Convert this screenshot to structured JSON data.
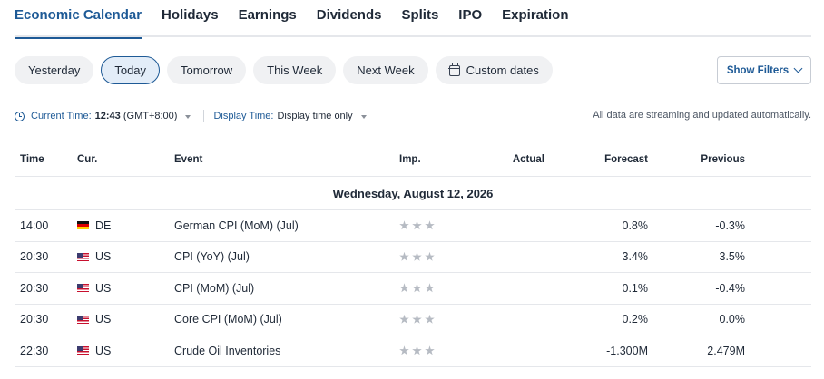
{
  "tabs": [
    {
      "label": "Economic Calendar",
      "active": true
    },
    {
      "label": "Holidays"
    },
    {
      "label": "Earnings"
    },
    {
      "label": "Dividends"
    },
    {
      "label": "Splits"
    },
    {
      "label": "IPO"
    },
    {
      "label": "Expiration"
    }
  ],
  "filters": {
    "yesterday": "Yesterday",
    "today": "Today",
    "tomorrow": "Tomorrow",
    "this_week": "This Week",
    "next_week": "Next Week",
    "custom_dates": "Custom dates",
    "show_filters": "Show Filters"
  },
  "timebar": {
    "current_label": "Current Time:",
    "current_time": "12:43",
    "timezone": "(GMT+8:00)",
    "display_label": "Display Time:",
    "display_value": "Display time only",
    "streaming_note": "All data are streaming and updated automatically."
  },
  "table": {
    "headers": {
      "time": "Time",
      "currency": "Cur.",
      "event": "Event",
      "importance": "Imp.",
      "actual": "Actual",
      "forecast": "Forecast",
      "previous": "Previous"
    },
    "date_label": "Wednesday, August 12, 2026",
    "rows": [
      {
        "time": "14:00",
        "flag": "de-flag-icon",
        "currency": "DE",
        "event": "German CPI (MoM) (Jul)",
        "importance": 3,
        "actual": "",
        "forecast": "0.8%",
        "previous": "-0.3%"
      },
      {
        "time": "20:30",
        "flag": "us-flag-icon",
        "currency": "US",
        "event": "CPI (YoY) (Jul)",
        "importance": 3,
        "actual": "",
        "forecast": "3.4%",
        "previous": "3.5%"
      },
      {
        "time": "20:30",
        "flag": "us-flag-icon",
        "currency": "US",
        "event": "CPI (MoM) (Jul)",
        "importance": 3,
        "actual": "",
        "forecast": "0.1%",
        "previous": "-0.4%"
      },
      {
        "time": "20:30",
        "flag": "us-flag-icon",
        "currency": "US",
        "event": "Core CPI (MoM) (Jul)",
        "importance": 3,
        "actual": "",
        "forecast": "0.2%",
        "previous": "0.0%"
      },
      {
        "time": "22:30",
        "flag": "us-flag-icon",
        "currency": "US",
        "event": "Crude Oil Inventories",
        "importance": 3,
        "actual": "",
        "forecast": "-1.300M",
        "previous": "2.479M"
      }
    ]
  },
  "colors": {
    "accent": "#1e5a96",
    "chip_bg": "#f0f1f3",
    "star": "#b6bbc3",
    "border": "#e5e7eb"
  }
}
